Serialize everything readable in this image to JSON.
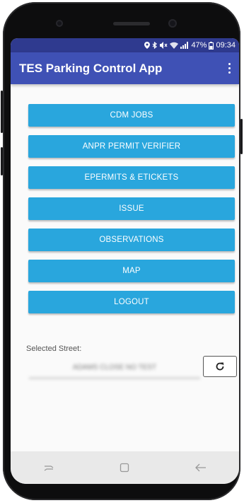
{
  "status_bar": {
    "battery": "47%",
    "time": "09:34"
  },
  "app_bar": {
    "title": "TES Parking Control App",
    "overflow_icon": "overflow-menu-icon"
  },
  "menu": {
    "items": [
      {
        "label": "CDM JOBS"
      },
      {
        "label": "ANPR PERMIT VERIFIER"
      },
      {
        "label": "EPERMITS & ETICKETS"
      },
      {
        "label": "ISSUE"
      },
      {
        "label": "OBSERVATIONS"
      },
      {
        "label": "MAP"
      },
      {
        "label": "LOGOUT"
      }
    ],
    "button_color": "#29a6dd"
  },
  "street": {
    "label": "Selected Street:",
    "value": "ADAMS CLOSE NO TEST",
    "refresh_icon": "refresh-icon"
  },
  "colors": {
    "primary": "#3f51b5",
    "status_bar": "#2f3a8f"
  },
  "nav_bar": {
    "icons": [
      "recent-apps-icon",
      "home-icon",
      "back-icon"
    ]
  }
}
